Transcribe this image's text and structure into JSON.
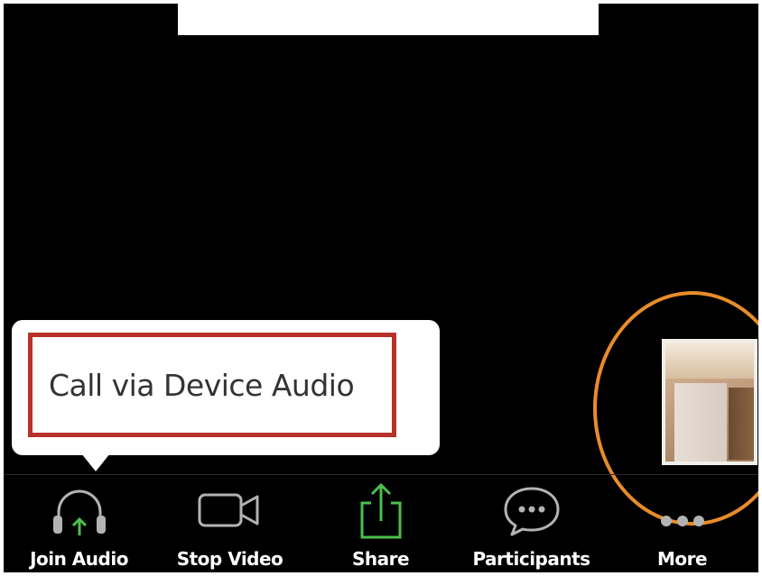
{
  "tooltip": {
    "text": "Call via Device Audio"
  },
  "toolbar": {
    "items": [
      {
        "label": "Join Audio",
        "icon": "headphones-join-icon"
      },
      {
        "label": "Stop Video",
        "icon": "video-camera-icon"
      },
      {
        "label": "Share",
        "icon": "share-upload-icon"
      },
      {
        "label": "Participants",
        "icon": "chat-bubble-icon"
      },
      {
        "label": "More",
        "icon": "more-dots-icon"
      }
    ]
  },
  "colors": {
    "background": "#000000",
    "highlight_box": "#b8312a",
    "annotation_circle": "#e88c2a",
    "accent_green": "#4bc04b",
    "icon_gray": "#b3b3b3"
  }
}
